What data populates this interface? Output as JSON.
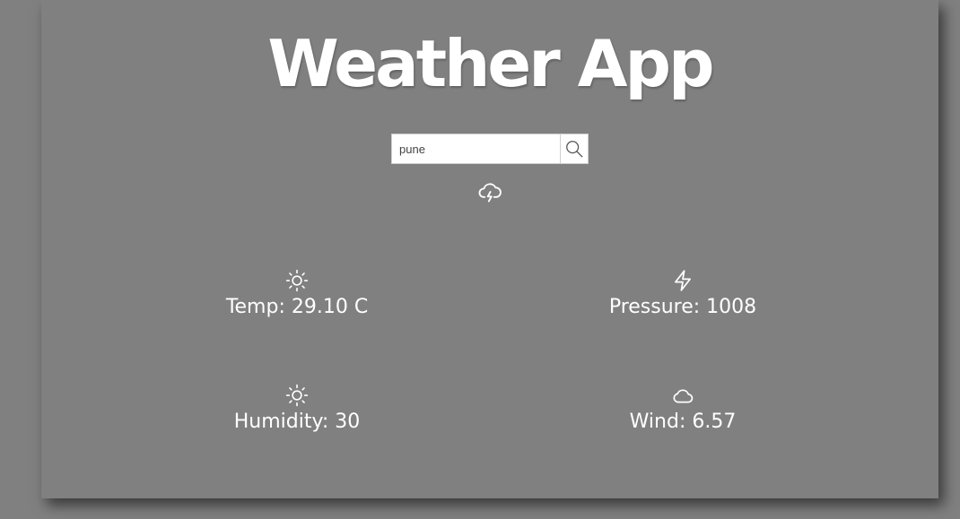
{
  "app": {
    "title": "Weather App"
  },
  "search": {
    "value": "pune",
    "button_icon": "search-icon"
  },
  "condition": {
    "icon": "cloud-lightning-icon"
  },
  "stats": {
    "temp": {
      "label": "Temp: 29.10 C",
      "icon": "sun-icon"
    },
    "pressure": {
      "label": "Pressure: 1008",
      "icon": "lightning-icon"
    },
    "humidity": {
      "label": "Humidity: 30",
      "icon": "sun-icon"
    },
    "wind": {
      "label": "Wind: 6.57",
      "icon": "cloud-icon"
    }
  },
  "colors": {
    "background": "#808080",
    "text": "#ffffff"
  }
}
